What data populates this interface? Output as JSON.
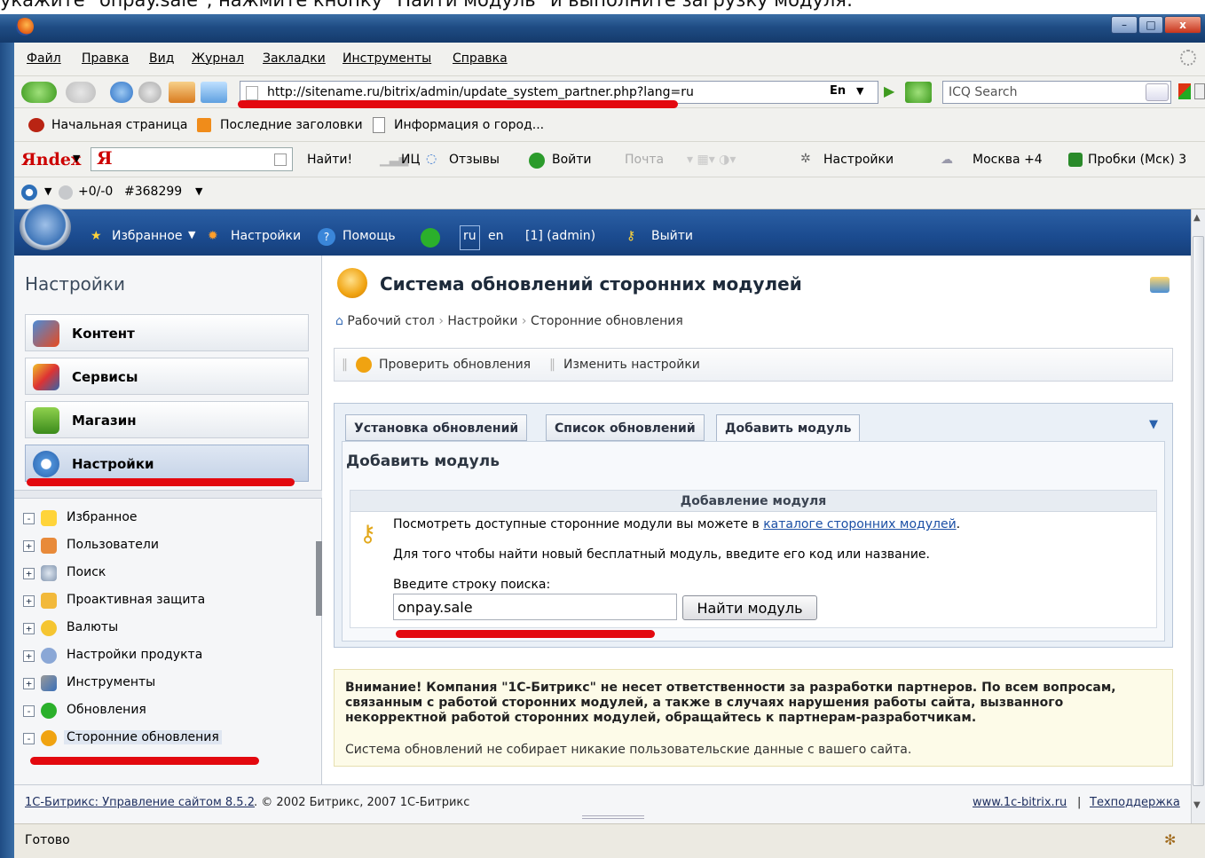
{
  "instruction": "укажите \"onpay.sale\", нажмите кнопку \"Найти модуль\" и выполните загрузку модуля:",
  "window_buttons": [
    "–",
    "□",
    "x"
  ],
  "menu": [
    "Файл",
    "Правка",
    "Вид",
    "Журнал",
    "Закладки",
    "Инструменты",
    "Справка"
  ],
  "address_bar": {
    "url": "http://sitename.ru/bitrix/admin/update_system_partner.php?lang=ru",
    "lang_indicator": "En"
  },
  "icq_search": {
    "placeholder": "ICQ Search"
  },
  "bookmarks": [
    "Начальная страница",
    "Последние заголовки",
    "Информация о город..."
  ],
  "yandex_bar": {
    "brand": "Яndex",
    "find": "Найти!",
    "ic": "ИЦ",
    "reviews": "Отзывы",
    "login": "Войти",
    "mail": "Почта",
    "settings": "Настройки",
    "weather": "Москва +4",
    "traffic": "Пробки (Мск) 3"
  },
  "icq_bar": {
    "counter": "+0/-0",
    "uin": "#368299"
  },
  "admin_bar": {
    "favorites": "Избранное",
    "settings": "Настройки",
    "help": "Помощь",
    "lang_ru": "ru",
    "lang_en": "en",
    "user": "[1] (admin)",
    "logout": "Выйти"
  },
  "left_panel": {
    "title": "Настройки",
    "sections": [
      "Контент",
      "Сервисы",
      "Магазин",
      "Настройки"
    ],
    "tree": [
      "Избранное",
      "Пользователи",
      "Поиск",
      "Проактивная защита",
      "Валюты",
      "Настройки продукта",
      "Инструменты",
      "Обновления",
      "Сторонние обновления"
    ]
  },
  "main": {
    "title": "Система обновлений сторонних модулей",
    "breadcrumb": [
      "Рабочий стол",
      "Настройки",
      "Сторонние обновления"
    ],
    "toolbar": {
      "check": "Проверить обновления",
      "change": "Изменить настройки"
    },
    "tabs": [
      "Установка обновлений",
      "Список обновлений",
      "Добавить модуль"
    ],
    "tab_heading": "Добавить модуль",
    "form": {
      "header": "Добавление модуля",
      "line1": "Посмотреть доступные сторонние модули вы можете в ",
      "line1_link": "каталоге сторонних модулей",
      "line1_end": ".",
      "line2": "Для того чтобы найти новый бесплатный модуль, введите его код или название.",
      "search_label": "Введите строку поиска:",
      "search_value": "onpay.sale",
      "find_button": "Найти модуль"
    },
    "notice": {
      "warning": "Внимание! Компания \"1С-Битрикс\" не несет ответственности за разработки партнеров. По всем вопросам, связанным с работой сторонних модулей, а также в случаях нарушения работы сайта, вызванного некорректной работой сторонних модулей, обращайтесь к партнерам-разработчикам.",
      "note": "Система обновлений не собирает никакие пользовательские данные с вашего сайта."
    }
  },
  "footer": {
    "product_link": "1С-Битрикс: Управление сайтом 8.5.2",
    "copyright": ". © 2002 Битрикс, 2007 1С-Битрикс",
    "site_link": "www.1c-bitrix.ru",
    "separator": "|",
    "support_link": "Техподдержка"
  },
  "status": "Готово",
  "colors": {
    "annotation_red": "#e3090f",
    "admin_blue": "#1b4b8f",
    "link": "#1b4fa5"
  }
}
